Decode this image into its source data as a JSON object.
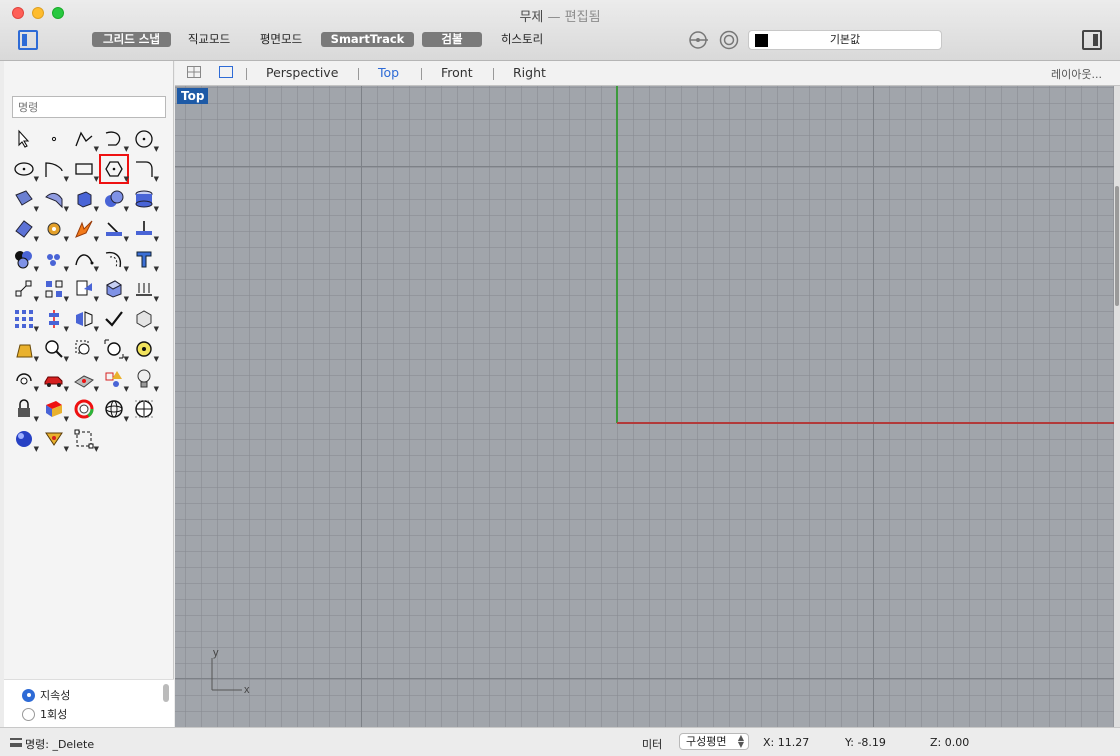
{
  "window": {
    "title": "무제",
    "title_status": "— 편집됨"
  },
  "toolbar": {
    "grid_snap": "그리드 스냅",
    "ortho": "직교모드",
    "planar": "평면모드",
    "smarttrack": "SmartTrack",
    "gumball": "검볼",
    "history": "히스토리",
    "layer": "기본값"
  },
  "command": {
    "placeholder": "명령"
  },
  "viewtabs": {
    "perspective": "Perspective",
    "top": "Top",
    "front": "Front",
    "right": "Right",
    "layout": "레이아웃..."
  },
  "viewport": {
    "label": "Top",
    "axis_y": "y",
    "axis_x": "x"
  },
  "options": {
    "persistent": "지속성",
    "once": "1회성"
  },
  "status": {
    "command": "명령: _Delete",
    "units": "미터",
    "cplane": "구성평면",
    "x": "X: 11.27",
    "y": "Y: -8.19",
    "z": "Z: 0.00"
  },
  "tools": [
    "select-arrow-icon",
    "point-icon",
    "polyline-icon",
    "curve-icon",
    "circle-icon",
    "ellipse-icon",
    "arc-icon",
    "rectangle-icon",
    "polygon-icon",
    "fillet-curve-icon",
    "surface-icon",
    "extrude-surface-icon",
    "box-icon",
    "solid-union-icon",
    "cylinder-pipe-icon",
    "surface-patch-icon",
    "gear-puzzle-icon",
    "explode-icon",
    "trim-icon",
    "split-icon",
    "boolean-icon",
    "points-group-icon",
    "curve-edit-icon",
    "offset-curve-icon",
    "text-icon",
    "transform-icon",
    "array-icon",
    "clipboard-icon",
    "block-icon",
    "dimension-icon",
    "grid-array-icon",
    "align-icon",
    "mirror-icon",
    "check-icon",
    "mesh-icon",
    "paint-bucket-icon",
    "zoom-icon",
    "zoom-window-icon",
    "zoom-extents-icon",
    "zoom-selected-icon",
    "rotate-view-icon",
    "car-icon",
    "render-mesh-icon",
    "shapes-icon",
    "light-icon",
    "lock-icon",
    "layer-book-icon",
    "color-wheel-icon",
    "wireframe-sphere-icon",
    "grid-sphere-icon",
    "material-sphere-icon",
    "camera-icon",
    "snap-box-icon"
  ],
  "colors": {
    "accent": "#2e6bd6",
    "viewport_bg": "#a1a5ab",
    "axis_x": "#b23a3a",
    "axis_y": "#3c9a3c",
    "selected_tool_outline": "#e11111"
  }
}
